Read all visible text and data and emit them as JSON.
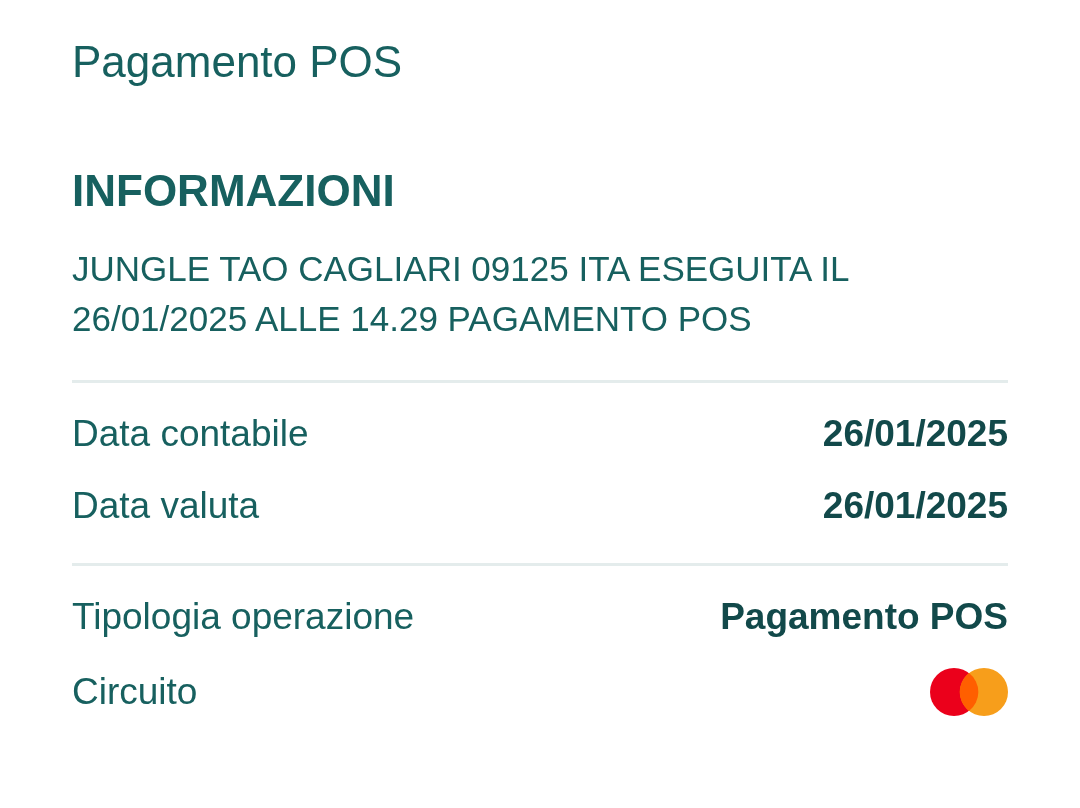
{
  "subtitle": "Pagamento POS",
  "section_title": "INFORMAZIONI",
  "description": "JUNGLE TAO CAGLIARI 09125 ITA ESEGUITA IL 26/01/2025 ALLE 14.29 PAGAMENTO POS",
  "groups": [
    {
      "rows": [
        {
          "kind": "text",
          "label": "Data contabile",
          "value": "26/01/2025"
        },
        {
          "kind": "text",
          "label": "Data valuta",
          "value": "26/01/2025"
        }
      ]
    },
    {
      "rows": [
        {
          "kind": "text",
          "label": "Tipologia operazione",
          "value": "Pagamento POS"
        },
        {
          "kind": "card_logo",
          "label": "Circuito"
        }
      ]
    }
  ]
}
